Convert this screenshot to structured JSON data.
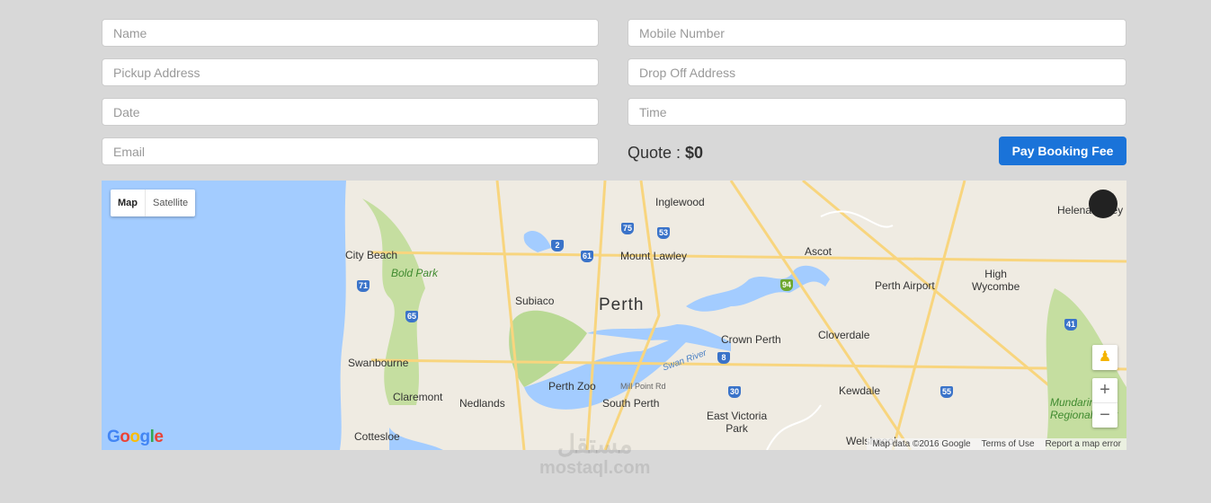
{
  "form": {
    "name_placeholder": "Name",
    "mobile_placeholder": "Mobile Number",
    "pickup_placeholder": "Pickup Address",
    "dropoff_placeholder": "Drop Off Address",
    "date_placeholder": "Date",
    "time_placeholder": "Time",
    "email_placeholder": "Email",
    "quote_label": "Quote : ",
    "quote_value": "$0",
    "pay_button": "Pay Booking Fee"
  },
  "map": {
    "type_map": "Map",
    "type_satellite": "Satellite",
    "labels": {
      "inglewood": "Inglewood",
      "mount_lawley": "Mount Lawley",
      "city_beach": "City Beach",
      "bold_park": "Bold Park",
      "subiaco": "Subiaco",
      "perth": "Perth",
      "ascot": "Ascot",
      "perth_airport": "Perth Airport",
      "high_wycombe": "High\nWycombe",
      "swanbourne": "Swanbourne",
      "claremont": "Claremont",
      "nedlands": "Nedlands",
      "perth_zoo": "Perth Zoo",
      "south_perth": "South Perth",
      "crown_perth": "Crown Perth",
      "cloverdale": "Cloverdale",
      "kewdale": "Kewdale",
      "east_victoria_park": "East Victoria\nPark",
      "cottesloe": "Cottesloe",
      "swan_river": "Swan River",
      "mill_point": "Mill Point Rd",
      "helena": "Helena Valley",
      "welshpool": "Welshpool",
      "munday": "Mundaring\nRegional Park"
    },
    "attribution": "Map data ©2016 Google",
    "terms": "Terms of Use",
    "report": "Report a map error",
    "logo": "Google",
    "zoom_in": "+",
    "zoom_out": "−"
  },
  "watermark": {
    "arabic": "مستقل",
    "latin": "mostaql.com"
  },
  "colors": {
    "accent": "#1a73d9",
    "water": "#a3ccff",
    "land": "#efebe2",
    "park": "#c5dea0",
    "road": "#f8d57e"
  }
}
